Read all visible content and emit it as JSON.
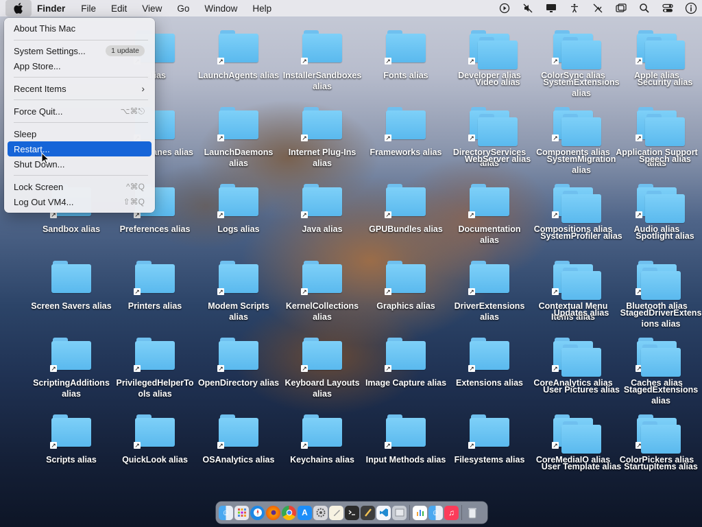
{
  "menubar": {
    "app": "Finder",
    "items": [
      "File",
      "Edit",
      "View",
      "Go",
      "Window",
      "Help"
    ]
  },
  "apple_menu": {
    "about": "About This Mac",
    "system_settings": "System Settings...",
    "update_badge": "1 update",
    "app_store": "App Store...",
    "recent_items": "Recent Items",
    "force_quit": "Force Quit...",
    "force_quit_shortcut": "⌥⌘⎋",
    "sleep": "Sleep",
    "restart": "Restart...",
    "shut_down": "Shut Down...",
    "lock_screen": "Lock Screen",
    "lock_screen_shortcut": "^⌘Q",
    "log_out": "Log Out VM4...",
    "log_out_shortcut": "⇧⌘Q"
  },
  "desktop": {
    "rows": [
      [
        "alias",
        "LaunchAgents alias",
        "InstallerSandboxes alias",
        "Fonts alias",
        "Developer alias",
        "ColorSync alias",
        "Apple alias"
      ],
      [
        "cePanes alias",
        "LaunchDaemons alias",
        "Internet Plug-Ins alias",
        "Frameworks alias",
        "DirectoryServices alias",
        "Components alias",
        "Application Support alias"
      ],
      [
        "Sandbox alias",
        "Preferences alias",
        "Logs alias",
        "Java alias",
        "GPUBundles alias",
        "Documentation alias",
        "Compositions alias",
        "Audio alias"
      ],
      [
        "Screen Savers alias",
        "Printers alias",
        "Modem Scripts alias",
        "KernelCollections alias",
        "Graphics alias",
        "DriverExtensions alias",
        "Contextual Menu Items alias",
        "Bluetooth alias"
      ],
      [
        "ScriptingAdditions alias",
        "PrivilegedHelperTools alias",
        "OpenDirectory alias",
        "Keyboard Layouts alias",
        "Image Capture alias",
        "Extensions alias",
        "CoreAnalytics alias",
        "Caches alias"
      ],
      [
        "Scripts alias",
        "QuickLook alias",
        "OSAnalytics alias",
        "Keychains alias",
        "Input Methods alias",
        "Filesystems alias",
        "CoreMediaIO alias",
        "ColorPickers alias"
      ]
    ],
    "overlap": [
      [
        "Video alias",
        "SystemExtensions alias",
        "Security alias"
      ],
      [
        "WebServer alias",
        "SystemMigration alias",
        "Speech alias"
      ],
      [
        "SystemProfiler alias",
        "Spotlight alias"
      ],
      [
        "Updates alias",
        "StagedDriverExtensions alias"
      ],
      [
        "User Pictures alias",
        "StagedExtensions alias"
      ],
      [
        "User Template alias",
        "StartupItems alias"
      ]
    ]
  },
  "colors": {
    "folder": "#5ab9ee",
    "selection": "#1665d8"
  }
}
